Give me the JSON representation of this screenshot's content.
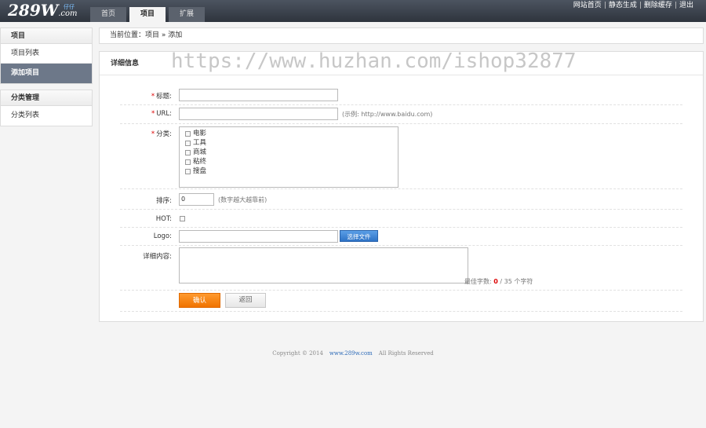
{
  "header": {
    "logo_main": "289W",
    "logo_suffix": ".com",
    "logo_tag": "仔仔",
    "tabs": [
      "首页",
      "项目",
      "扩展"
    ],
    "links": [
      "网站首页",
      "静态生成",
      "删除缓存",
      "退出"
    ]
  },
  "sidebar": {
    "groups": [
      {
        "title": "项目",
        "items": [
          "项目列表",
          "添加项目"
        ]
      },
      {
        "title": "分类管理",
        "items": [
          "分类列表"
        ]
      }
    ]
  },
  "breadcrumb": "当前位置：项目 » 添加",
  "panel": {
    "title": "详细信息"
  },
  "watermark": "https://www.huzhan.com/ishop32877",
  "form": {
    "title_label": "标题:",
    "url_label": "URL:",
    "url_hint": "(示例: http://www.baidu.com)",
    "category_label": "分类:",
    "categories": [
      "电影",
      "工具",
      "商城",
      "粘终",
      "搜盘"
    ],
    "sort_label": "排序:",
    "sort_value": "0",
    "sort_hint": "(数字越大越靠前)",
    "hot_label": "HOT:",
    "logo_label": "Logo:",
    "file_button": "选择文件",
    "content_label": "详细内容:",
    "char_hint_prefix": "最佳字数:",
    "char_count": "0",
    "char_hint_suffix": "/ 35 个字符",
    "submit_label": "确认",
    "back_label": "返回"
  },
  "footer": {
    "copyright": "Copyright © 2014",
    "site": "www.289w.com",
    "rights": "All Rights Reserved"
  }
}
